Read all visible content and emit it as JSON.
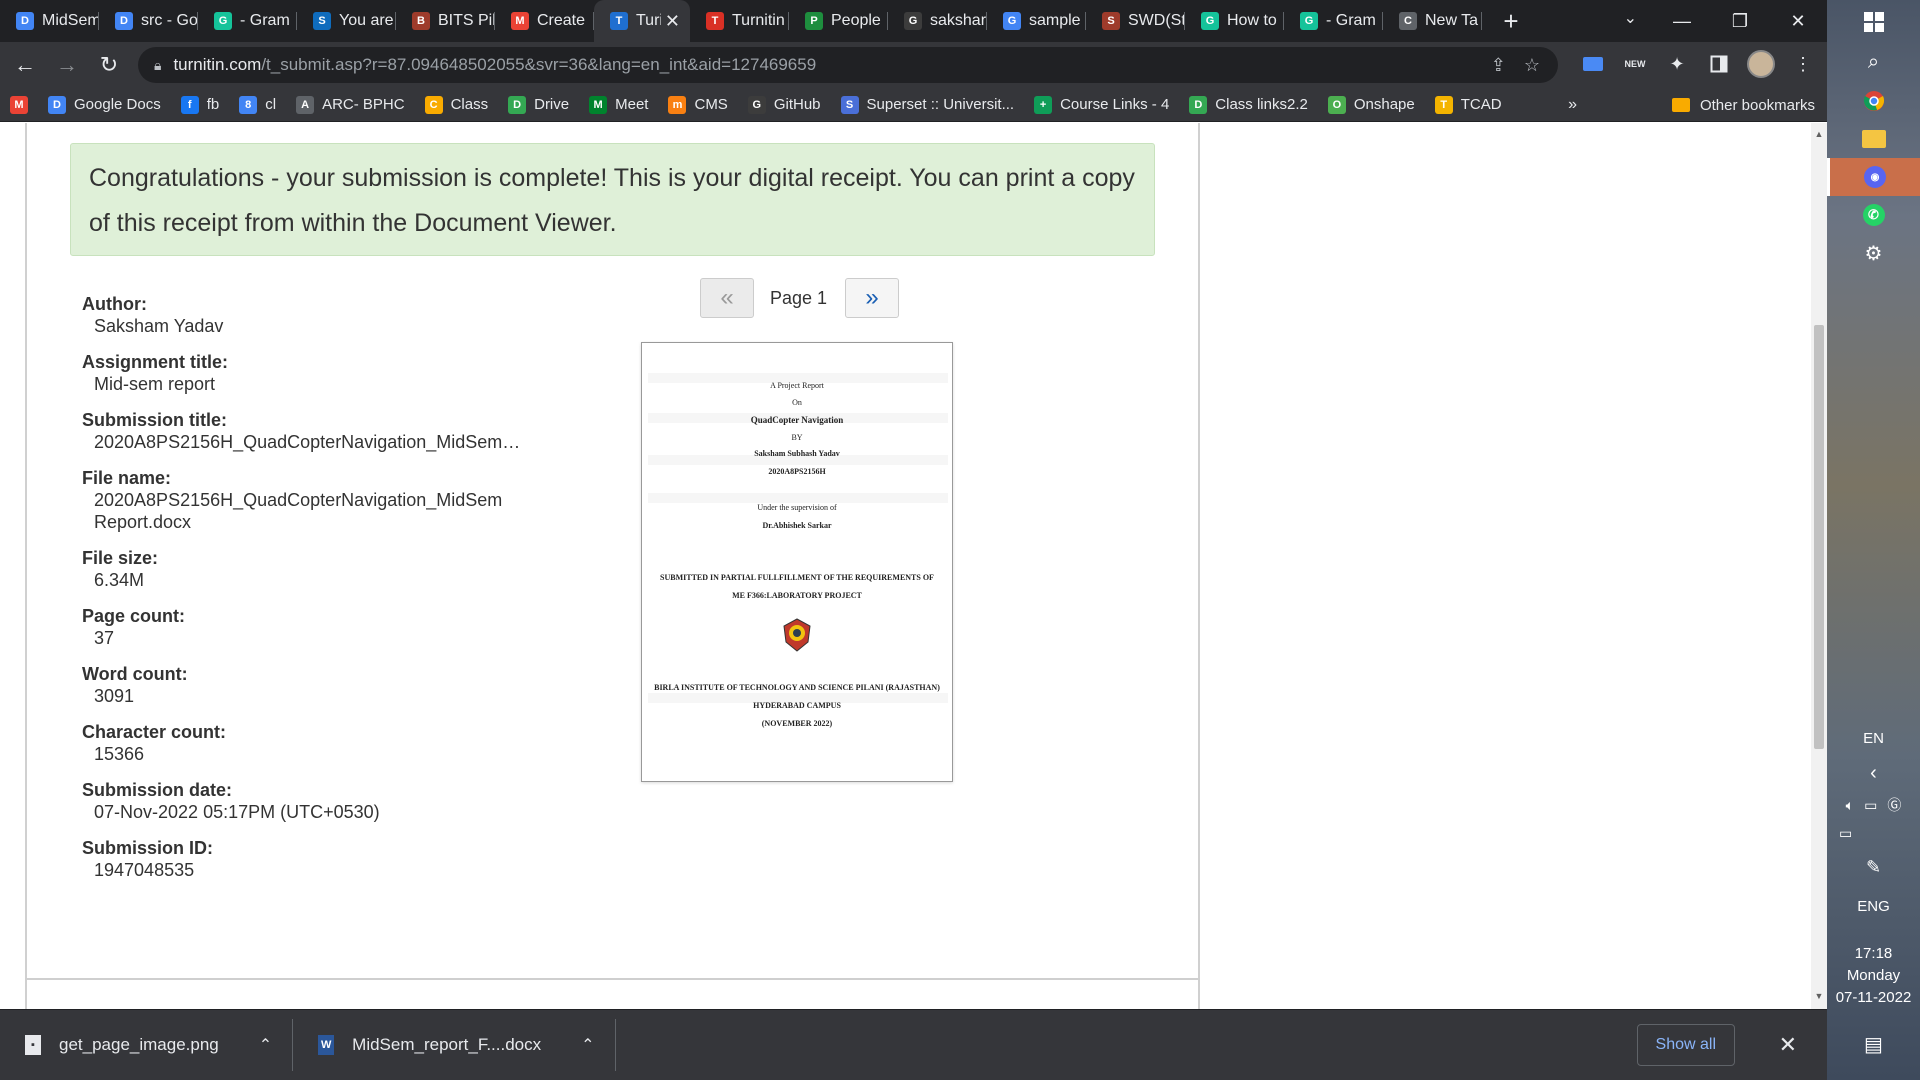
{
  "browser": {
    "tabs": [
      {
        "title": "MidSem",
        "icon": "google-docs-icon",
        "color": "#4285f4",
        "glyph": "D"
      },
      {
        "title": "src - Go",
        "icon": "google-docs-icon",
        "color": "#4285f4",
        "glyph": "D"
      },
      {
        "title": "- Gram",
        "icon": "grammarly-icon",
        "color": "#15c39a",
        "glyph": "G"
      },
      {
        "title": "You are",
        "icon": "sharepoint-icon",
        "color": "#0f6cbd",
        "glyph": "S"
      },
      {
        "title": "BITS Pil",
        "icon": "bits-logo-icon",
        "color": "#9e3b2b",
        "glyph": "B"
      },
      {
        "title": "Create",
        "icon": "gmail-icon",
        "color": "#ea4335",
        "glyph": "M"
      },
      {
        "title": "Turi",
        "icon": "turnitin-icon",
        "color": "#1f6fd0",
        "glyph": "T",
        "active": true
      },
      {
        "title": "Turnitin",
        "icon": "turnitin-red-icon",
        "color": "#d93025",
        "glyph": "T"
      },
      {
        "title": "People",
        "icon": "google-classroom-icon",
        "color": "#1e8e3e",
        "glyph": "P"
      },
      {
        "title": "sakshar",
        "icon": "github-icon",
        "color": "#3c3c3c",
        "glyph": "G"
      },
      {
        "title": "sample",
        "icon": "google-icon",
        "color": "#4285f4",
        "glyph": "G"
      },
      {
        "title": "SWD(St",
        "icon": "bits-logo-icon",
        "color": "#9e3b2b",
        "glyph": "S"
      },
      {
        "title": "How to",
        "icon": "grammarly-icon",
        "color": "#15c39a",
        "glyph": "G"
      },
      {
        "title": "- Gram",
        "icon": "grammarly-icon",
        "color": "#15c39a",
        "glyph": "G"
      },
      {
        "title": "New Ta",
        "icon": "chrome-icon",
        "color": "#5f6368",
        "glyph": "C"
      }
    ],
    "address": {
      "host": "turnitin.com",
      "path": "/t_submit.asp?r=87.094648502055&svr=36&lang=en_int&aid=127469659"
    },
    "bookmarks": [
      {
        "label": "",
        "icon": "gmail-icon",
        "color": "#ea4335",
        "glyph": "M"
      },
      {
        "label": "Google Docs",
        "icon": "google-docs-icon",
        "color": "#4285f4",
        "glyph": "D"
      },
      {
        "label": "fb",
        "icon": "facebook-icon",
        "color": "#1877f2",
        "glyph": "f"
      },
      {
        "label": "cl",
        "icon": "calendar-icon",
        "color": "#4285f4",
        "glyph": "8"
      },
      {
        "label": "ARC- BPHC",
        "icon": "arc-icon",
        "color": "#5f6368",
        "glyph": "A"
      },
      {
        "label": "Class",
        "icon": "google-classroom-icon",
        "color": "#f9ab00",
        "glyph": "C"
      },
      {
        "label": "Drive",
        "icon": "google-drive-icon",
        "color": "#34a853",
        "glyph": "D"
      },
      {
        "label": "Meet",
        "icon": "google-meet-icon",
        "color": "#00832d",
        "glyph": "M"
      },
      {
        "label": "CMS",
        "icon": "moodle-icon",
        "color": "#f98012",
        "glyph": "m"
      },
      {
        "label": "GitHub",
        "icon": "github-icon",
        "color": "#3c3c3c",
        "glyph": "G"
      },
      {
        "label": "Superset :: Universit...",
        "icon": "superset-icon",
        "color": "#4a6fd8",
        "glyph": "S"
      },
      {
        "label": "Course Links - 4",
        "icon": "google-sheets-plus-icon",
        "color": "#0f9d58",
        "glyph": "+"
      },
      {
        "label": "Class links2.2",
        "icon": "google-drive-icon",
        "color": "#34a853",
        "glyph": "D"
      },
      {
        "label": "Onshape",
        "icon": "onshape-icon",
        "color": "#4caf50",
        "glyph": "O"
      },
      {
        "label": "TCAD",
        "icon": "spreadsheet-icon",
        "color": "#f4b400",
        "glyph": "T"
      }
    ],
    "bookmarks_more": "»",
    "other_bookmarks": "Other bookmarks"
  },
  "receipt": {
    "message": "Congratulations - your submission is complete! This is your digital receipt. You can print a copy of this receipt from within the Document Viewer.",
    "fields": [
      {
        "label": "Author:",
        "value": "Saksham Yadav"
      },
      {
        "label": "Assignment title:",
        "value": "Mid-sem report"
      },
      {
        "label": "Submission title:",
        "value": "2020A8PS2156H_QuadCopterNavigation_MidSem…"
      },
      {
        "label": "File name:",
        "value": "2020A8PS2156H_QuadCopterNavigation_MidSem Report.docx"
      },
      {
        "label": "File size:",
        "value": "6.34M"
      },
      {
        "label": "Page count:",
        "value": "37"
      },
      {
        "label": "Word count:",
        "value": "3091"
      },
      {
        "label": "Character count:",
        "value": "15366"
      },
      {
        "label": "Submission date:",
        "value": "07-Nov-2022 05:17PM (UTC+0530)"
      },
      {
        "label": "Submission ID:",
        "value": "1947048535"
      }
    ],
    "pager": {
      "prev": "«",
      "label": "Page 1",
      "next": "»"
    },
    "thumbnail": {
      "lines": [
        "A Project Report",
        "On",
        "QuadCopter Navigation",
        "BY",
        "Saksham Subhash Yadav",
        "2020A8PS2156H",
        "Under the supervision of",
        "Dr.Abhishek Sarkar",
        "SUBMITTED IN PARTIAL FULLFILLMENT OF THE REQUIREMENTS OF",
        "ME F366:LABORATORY PROJECT",
        "BIRLA INSTITUTE OF TECHNOLOGY AND SCIENCE PILANI (RAJASTHAN)",
        "HYDERABAD CAMPUS",
        "(NOVEMBER 2022)"
      ]
    }
  },
  "downloads": [
    {
      "name": "get_page_image.png",
      "icon": "image-file-icon"
    },
    {
      "name": "MidSem_report_F....docx",
      "icon": "word-file-icon"
    }
  ],
  "show_all": "Show all",
  "taskbar": {
    "language": "EN",
    "input": "ENG",
    "time": "17:18",
    "day": "Monday",
    "date": "07-11-2022"
  }
}
